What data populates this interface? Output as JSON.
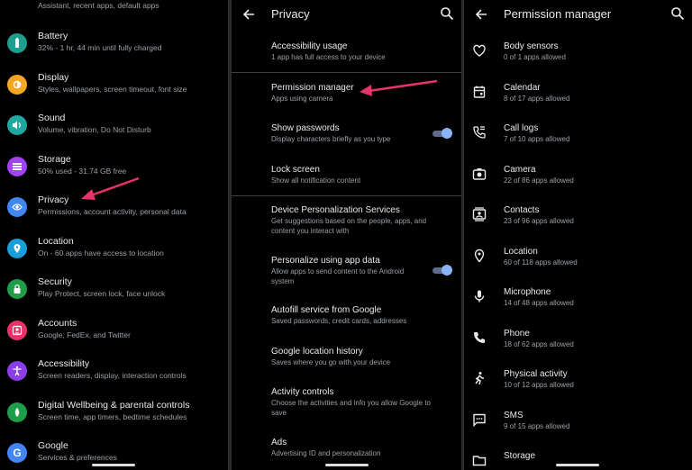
{
  "colors": {
    "accent_arrow": "#e8336a",
    "toggle_on": "#8ab4f8"
  },
  "settings": {
    "top_partial": "Assistant, recent apps, default apps",
    "items": [
      {
        "title": "Battery",
        "sub": "32% - 1 hr, 44 min until fully charged",
        "icon": "battery-icon",
        "color": "#1e9e8e"
      },
      {
        "title": "Display",
        "sub": "Styles, wallpapers, screen timeout, font size",
        "icon": "brightness-icon",
        "color": "#f5a623"
      },
      {
        "title": "Sound",
        "sub": "Volume, vibration, Do Not Disturb",
        "icon": "volume-icon",
        "color": "#1ea89f"
      },
      {
        "title": "Storage",
        "sub": "50% used - 31.74 GB free",
        "icon": "storage-icon",
        "color": "#a142f4"
      },
      {
        "title": "Privacy",
        "sub": "Permissions, account activity, personal data",
        "icon": "privacy-eye-icon",
        "color": "#4285f4"
      },
      {
        "title": "Location",
        "sub": "On - 60 apps have access to location",
        "icon": "location-pin-icon",
        "color": "#1a9ed9"
      },
      {
        "title": "Security",
        "sub": "Play Protect, screen lock, face unlock",
        "icon": "lock-icon",
        "color": "#1e9e4a"
      },
      {
        "title": "Accounts",
        "sub": "Google, FedEx, and Twitter",
        "icon": "account-icon",
        "color": "#e8336a"
      },
      {
        "title": "Accessibility",
        "sub": "Screen readers, display, interaction controls",
        "icon": "accessibility-icon",
        "color": "#8b3de8"
      },
      {
        "title": "Digital Wellbeing & parental controls",
        "sub": "Screen time, app timers, bedtime schedules",
        "icon": "wellbeing-icon",
        "color": "#1e9e4a"
      },
      {
        "title": "Google",
        "sub": "Services & preferences",
        "icon": "google-g-icon",
        "color": "#4285f4"
      }
    ]
  },
  "privacy": {
    "title": "Privacy",
    "items": [
      {
        "title": "Accessibility usage",
        "sub": "1 app has full access to your device"
      },
      {
        "title": "Permission manager",
        "sub": "Apps using camera"
      },
      {
        "title": "Show passwords",
        "sub": "Display characters briefly as you type",
        "toggle": true
      },
      {
        "title": "Lock screen",
        "sub": "Show all notification content"
      },
      {
        "title": "Device Personalization Services",
        "sub": "Get suggestions based on the people, apps, and content you interact with"
      },
      {
        "title": "Personalize using app data",
        "sub": "Allow apps to send content to the Android system",
        "toggle": true
      },
      {
        "title": "Autofill service from Google",
        "sub": "Saved passwords, credit cards, addresses"
      },
      {
        "title": "Google location history",
        "sub": "Saves where you go with your device"
      },
      {
        "title": "Activity controls",
        "sub": "Choose the activities and info you allow Google to save"
      },
      {
        "title": "Ads",
        "sub": "Advertising ID and personalization"
      }
    ]
  },
  "permission_manager": {
    "title": "Permission manager",
    "items": [
      {
        "title": "Body sensors",
        "sub": "0 of 1 apps allowed",
        "icon": "heart-icon"
      },
      {
        "title": "Calendar",
        "sub": "8 of 17 apps allowed",
        "icon": "calendar-icon"
      },
      {
        "title": "Call logs",
        "sub": "7 of 10 apps allowed",
        "icon": "call-log-icon"
      },
      {
        "title": "Camera",
        "sub": "22 of 86 apps allowed",
        "icon": "camera-icon"
      },
      {
        "title": "Contacts",
        "sub": "23 of 96 apps allowed",
        "icon": "contacts-icon"
      },
      {
        "title": "Location",
        "sub": "60 of 118 apps allowed",
        "icon": "location-pin-icon"
      },
      {
        "title": "Microphone",
        "sub": "14 of 48 apps allowed",
        "icon": "microphone-icon"
      },
      {
        "title": "Phone",
        "sub": "18 of 62 apps allowed",
        "icon": "phone-icon"
      },
      {
        "title": "Physical activity",
        "sub": "10 of 12 apps allowed",
        "icon": "walking-icon"
      },
      {
        "title": "SMS",
        "sub": "9 of 15 apps allowed",
        "icon": "sms-icon"
      },
      {
        "title": "Storage",
        "sub": "",
        "icon": "folder-icon"
      }
    ]
  }
}
